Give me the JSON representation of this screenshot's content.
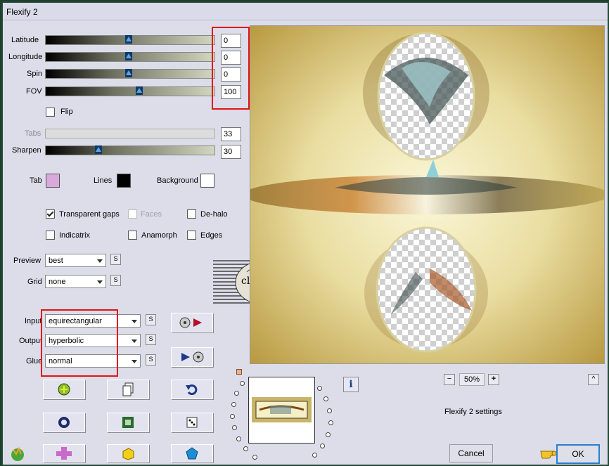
{
  "window": {
    "title": "Flexify 2"
  },
  "sliders": [
    {
      "label": "Latitude",
      "value": "0",
      "fraction": 0.4
    },
    {
      "label": "Longitude",
      "value": "0",
      "fraction": 0.4
    },
    {
      "label": "Spin",
      "value": "0",
      "fraction": 0.4
    },
    {
      "label": "FOV",
      "value": "100",
      "fraction": 0.44
    }
  ],
  "flip": {
    "label": "Flip",
    "checked": false
  },
  "tabs": {
    "label": "Tabs",
    "value": "33"
  },
  "sharpen": {
    "label": "Sharpen",
    "value": "30",
    "fraction": 0.25
  },
  "colors": {
    "tab": {
      "label": "Tab",
      "color": "#d9a9dd"
    },
    "lines": {
      "label": "Lines",
      "color": "#000000"
    },
    "background": {
      "label": "Background",
      "color": "#ffffff"
    }
  },
  "options": {
    "transparent_gaps": "Transparent gaps",
    "faces": "Faces",
    "dehalo": "De-halo",
    "indicatrix": "Indicatrix",
    "anamorph": "Anamorph",
    "edges": "Edges"
  },
  "selects": {
    "preview": {
      "label": "Preview",
      "value": "best"
    },
    "grid": {
      "label": "Grid",
      "value": "none"
    },
    "input": {
      "label": "Input",
      "value": "equirectangular"
    },
    "output": {
      "label": "Output",
      "value": "hyperbolic"
    },
    "glue": {
      "label": "Glue",
      "value": "normal"
    }
  },
  "s_button": "S",
  "watermark": {
    "text": "claudia"
  },
  "zoom": {
    "minus": "−",
    "value": "50%",
    "plus": "+"
  },
  "info_icon": "i",
  "caret": "^",
  "settings_label": "Flexify 2 settings",
  "buttons": {
    "cancel": "Cancel",
    "ok": "OK"
  },
  "accent_red": "#e21515"
}
